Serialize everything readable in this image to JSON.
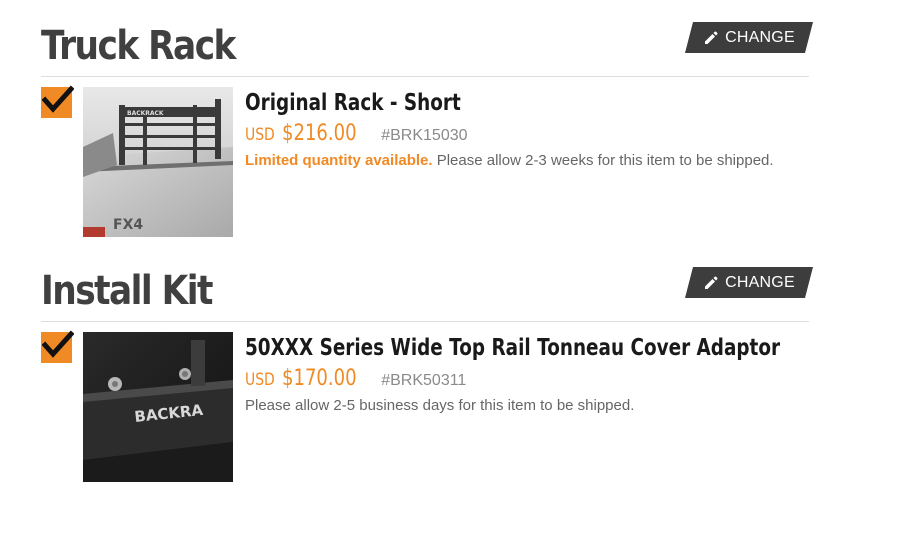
{
  "sections": [
    {
      "title": "Truck Rack",
      "change_label": "CHANGE",
      "item": {
        "name": "Original Rack - Short",
        "currency": "USD",
        "price": "$216.00",
        "sku": "#BRK15030",
        "availability_highlight": "Limited quantity available.",
        "availability_text": " Please allow 2-3 weeks for this item to be shipped.",
        "selected": true
      }
    },
    {
      "title": "Install Kit",
      "change_label": "CHANGE",
      "item": {
        "name": "50XXX Series Wide Top Rail Tonneau Cover Adaptor",
        "currency": "USD",
        "price": "$170.00",
        "sku": "#BRK50311",
        "availability_highlight": "",
        "availability_text": "Please allow 2-5 business days for this item to be shipped.",
        "selected": true
      }
    }
  ],
  "images": {
    "rack_image_text": "BACKRACK",
    "rack_badge_text": "FX4",
    "kit_image_text": "BACKRA"
  },
  "colors": {
    "accent": "#f08a24",
    "button_bg": "#3d3d3d",
    "title": "#404040",
    "sku": "#8a8a8a",
    "rule": "#dedede"
  },
  "icons": {
    "change": "pencil-icon",
    "checkbox": "checkmark-icon"
  }
}
